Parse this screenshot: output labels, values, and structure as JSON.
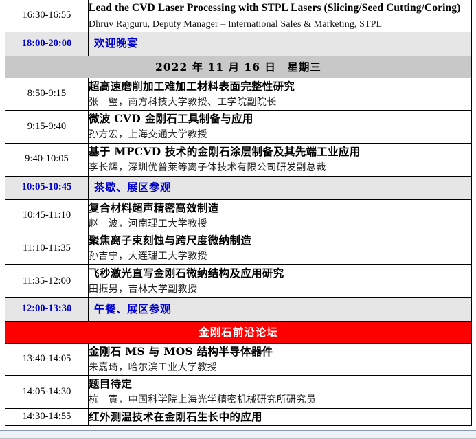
{
  "document": {
    "type": "conference-schedule-table",
    "columns": [
      "time",
      "session"
    ],
    "colors": {
      "break_row_bg": "#e6e6e6",
      "break_text": "#0000cd",
      "date_band_bg": "#c8c8c8",
      "forum_band_bg": "#ff0000",
      "forum_text": "#ffffff",
      "border": "#000000",
      "page_edge": "#eef1f6"
    }
  },
  "rows": [
    {
      "kind": "session",
      "time": "16:30-16:55",
      "title": "Lead the CVD Laser Processing with STPL Lasers (Slicing/Seed Cutting/Coring)",
      "title_lang": "en",
      "speaker": "Dhruv Rajguru, Deputy Manager – International Sales & Marketing, STPL",
      "speaker_lang": "en"
    },
    {
      "kind": "break",
      "time": "18:00-20:00",
      "label": "欢迎晚宴"
    },
    {
      "kind": "date",
      "text": "2022 年 11 月 16 日　星期三"
    },
    {
      "kind": "session",
      "time": "8:50-9:15",
      "title": "超高速磨削加工难加工材料表面完整性研究",
      "title_lang": "cn",
      "speaker": "张　璧，南方科技大学教授、工学院副院长",
      "speaker_lang": "cn"
    },
    {
      "kind": "session",
      "time": "9:15-9:40",
      "title": "微波 CVD 金刚石工具制备与应用",
      "title_lang": "cn",
      "speaker": "孙方宏，上海交通大学教授",
      "speaker_lang": "cn"
    },
    {
      "kind": "session",
      "time": "9:40-10:05",
      "title": "基于 MPCVD 技术的金刚石涂层制备及其先端工业应用",
      "title_lang": "cn",
      "speaker": "李长辉，深圳优普莱等离子体技术有限公司研发副总裁",
      "speaker_lang": "cn"
    },
    {
      "kind": "break",
      "time": "10:05-10:45",
      "label": "茶歇、展区参观"
    },
    {
      "kind": "session",
      "time": "10:45-11:10",
      "title": "复合材料超声精密高效制造",
      "title_lang": "cn",
      "speaker": "赵　波，河南理工大学教授",
      "speaker_lang": "cn"
    },
    {
      "kind": "session",
      "time": "11:10-11:35",
      "title": "聚焦离子束刻蚀与跨尺度微纳制造",
      "title_lang": "cn",
      "speaker": "孙吉宁，大连理工大学教授",
      "speaker_lang": "cn"
    },
    {
      "kind": "session",
      "time": "11:35-12:00",
      "title": "飞秒激光直写金刚石微纳结构及应用研究",
      "title_lang": "cn",
      "speaker": "田振男，吉林大学副教授",
      "speaker_lang": "cn"
    },
    {
      "kind": "break",
      "time": "12:00-13:30",
      "label": "午餐、展区参观"
    },
    {
      "kind": "forum",
      "text": "金刚石前沿论坛"
    },
    {
      "kind": "session",
      "time": "13:40-14:05",
      "title": "金刚石 MS 与 MOS 结构半导体器件",
      "title_lang": "cn",
      "speaker": "朱嘉琦，哈尔滨工业大学教授",
      "speaker_lang": "cn"
    },
    {
      "kind": "session",
      "time": "14:05-14:30",
      "title": "题目待定",
      "title_lang": "cn",
      "speaker": "杭　寅，中国科学院上海光学精密机械研究所研究员",
      "speaker_lang": "cn"
    },
    {
      "kind": "session",
      "time": "14:30-14:55",
      "title": "红外测温技术在金刚石生长中的应用",
      "title_lang": "cn",
      "speaker": "",
      "speaker_lang": "cn"
    }
  ]
}
